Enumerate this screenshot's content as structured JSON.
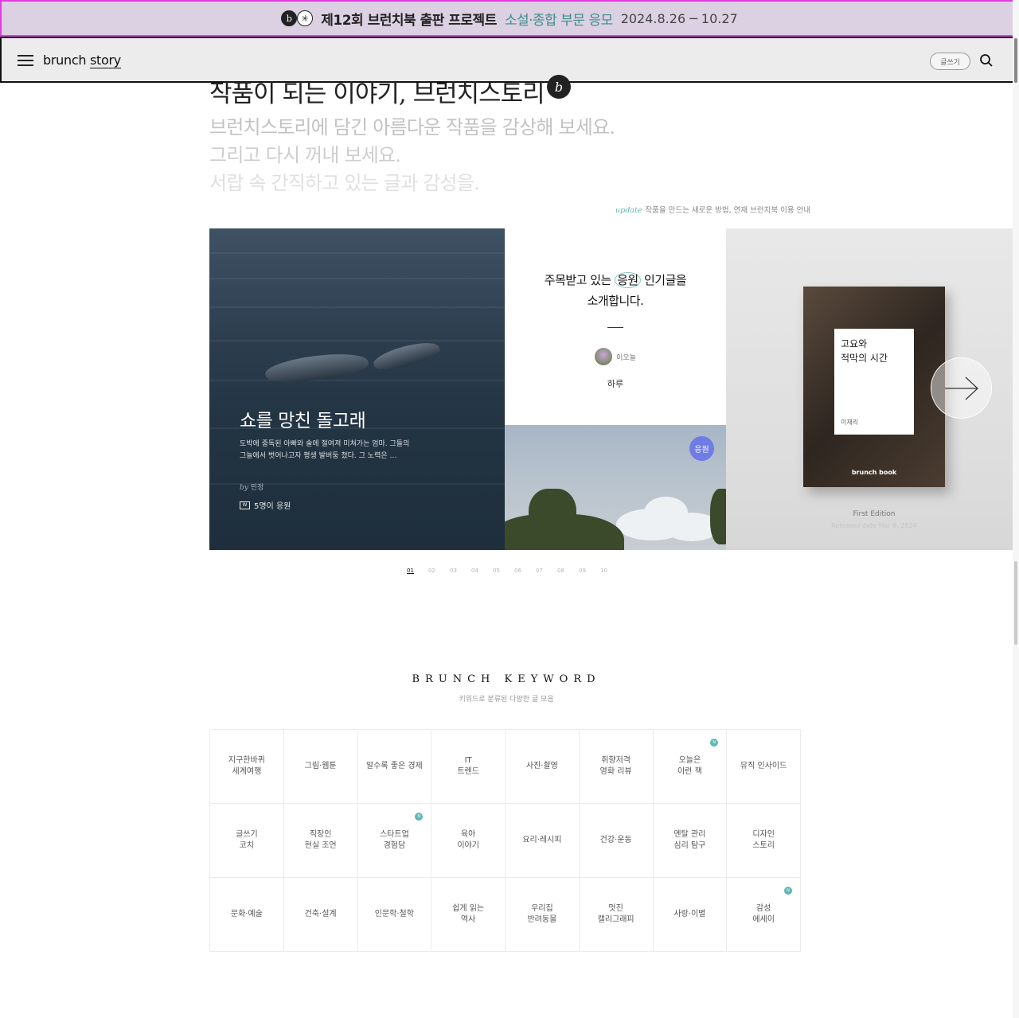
{
  "promo": {
    "t1": "제12회 브런치북 출판 프로젝트",
    "t2": "소설·종합 부문 응모",
    "t3": "2024.8.26 ─ 10.27",
    "logo_b": "b",
    "logo_star": "✳"
  },
  "header": {
    "logo": "brunch",
    "logo2": "story",
    "write": "글쓰기"
  },
  "intro": {
    "title": "작품이 되는 이야기, 브런치스토리",
    "badge": "b",
    "lines": [
      "브런치스토리에 담긴 아름다운 작품을 감상해 보세요.",
      "그리고 다시 꺼내 보세요.",
      "서랍 속 간직하고 있는 글과 감성을."
    ],
    "update_tag": "update",
    "update_text": "작품을 만드는 새로운 방법, 연재 브런치북 이용 안내"
  },
  "card_left": {
    "title": "쇼를 망친 돌고래",
    "desc": "도박에 중독된 아빠와 술에 절여져 미쳐가는 엄마. 그들의 그늘에서 벗어나고자 평생 발버둥 쳤다. 그 노력은 …",
    "by": "by",
    "author": "민정",
    "cheer": "5명이 응원",
    "cheer_icon": "W"
  },
  "card_mid": {
    "head1": "주목받고 있는 ",
    "head_circ": "응원",
    "head2": " 인기글을",
    "head3": "소개합니다.",
    "author": "이오늘",
    "subtitle": "하루",
    "badge": "응원"
  },
  "card_right": {
    "book_title1": "고요와",
    "book_title2": "적막의 시간",
    "book_author": "이재리",
    "brand": "brunch book",
    "edition": "First Edition",
    "released": "Released date Mar 9, 2024"
  },
  "pager": [
    "01",
    "02",
    "03",
    "04",
    "05",
    "06",
    "07",
    "08",
    "09",
    "10"
  ],
  "keyword": {
    "title": "BRUNCH KEYWORD",
    "subtitle": "키워드로 분류된 다양한 글 모음",
    "new_mark": "N",
    "items": [
      {
        "label": "지구한바퀴\n세계여행",
        "new": false
      },
      {
        "label": "그림·웹툰",
        "new": false
      },
      {
        "label": "알수록 좋은 경제",
        "new": false
      },
      {
        "label": "IT\n트렌드",
        "new": false
      },
      {
        "label": "사진·촬영",
        "new": false
      },
      {
        "label": "취향저격\n영화 리뷰",
        "new": false
      },
      {
        "label": "오늘은\n이런 책",
        "new": true
      },
      {
        "label": "뮤직 인사이드",
        "new": false
      },
      {
        "label": "글쓰기\n코치",
        "new": false
      },
      {
        "label": "직장인\n현실 조언",
        "new": false
      },
      {
        "label": "스타트업\n경험담",
        "new": true
      },
      {
        "label": "육아\n이야기",
        "new": false
      },
      {
        "label": "요리·레시피",
        "new": false
      },
      {
        "label": "건강·운동",
        "new": false
      },
      {
        "label": "멘탈 관리\n심리 탐구",
        "new": false
      },
      {
        "label": "디자인\n스토리",
        "new": false
      },
      {
        "label": "문화·예술",
        "new": false
      },
      {
        "label": "건축·설계",
        "new": false
      },
      {
        "label": "인문학·철학",
        "new": false
      },
      {
        "label": "쉽게 읽는\n역사",
        "new": false
      },
      {
        "label": "우리집\n반려동물",
        "new": false
      },
      {
        "label": "멋진\n캘리그래피",
        "new": false
      },
      {
        "label": "사랑·이별",
        "new": false
      },
      {
        "label": "감성\n에세이",
        "new": true
      }
    ]
  },
  "colors": {
    "accent": "#5cb8b3",
    "promo_bg": "#dcd0e3",
    "cheer_badge": "#6f7ce6"
  }
}
